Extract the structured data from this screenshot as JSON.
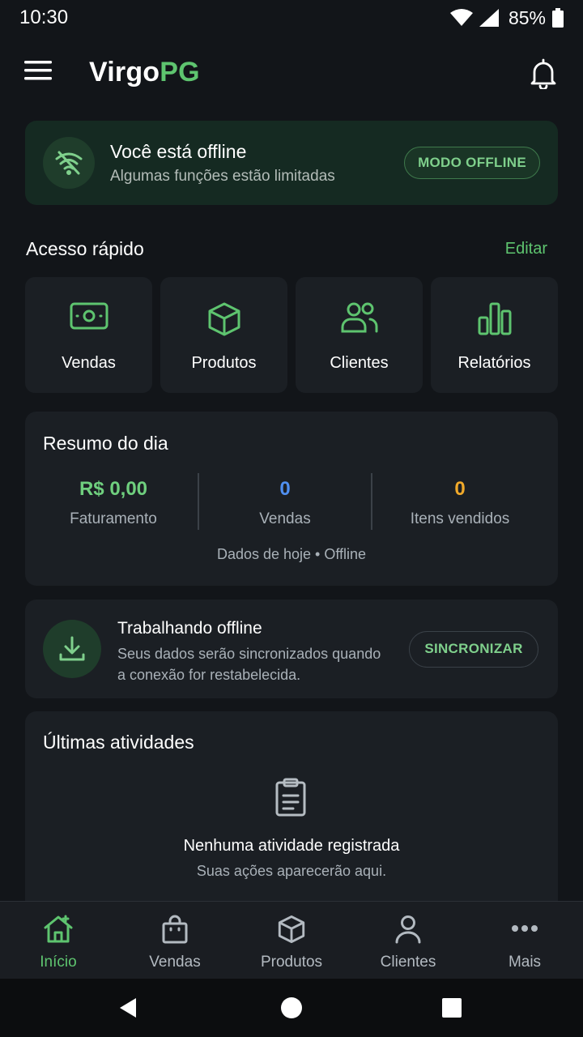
{
  "status_bar": {
    "time": "10:30",
    "battery": "85%"
  },
  "app_bar": {
    "title_main": "Virgo",
    "title_accent": "PG"
  },
  "offline_banner": {
    "title": "Você está offline",
    "subtitle": "Algumas funções estão limitadas",
    "mode_button": "MODO OFFLINE"
  },
  "quick_access": {
    "title": "Acesso rápido",
    "edit_label": "Editar",
    "items": [
      {
        "label": "Vendas",
        "icon": "money-icon"
      },
      {
        "label": "Produtos",
        "icon": "box-icon"
      },
      {
        "label": "Clientes",
        "icon": "users-icon"
      },
      {
        "label": "Relatórios",
        "icon": "bar-chart-icon"
      }
    ]
  },
  "summary": {
    "title": "Resumo do dia",
    "metrics": [
      {
        "value": "R$ 0,00",
        "label": "Faturamento",
        "color": "#6fcf7e"
      },
      {
        "value": "0",
        "label": "Vendas",
        "color": "#4f8ff0"
      },
      {
        "value": "0",
        "label": "Itens vendidos",
        "color": "#f0a92a"
      }
    ],
    "footer": "Dados de hoje • Offline"
  },
  "sync": {
    "title": "Trabalhando offline",
    "subtitle": "Seus dados serão sincronizados quando a conexão for restabelecida.",
    "button": "SINCRONIZAR"
  },
  "activities": {
    "title": "Últimas atividades",
    "empty_title": "Nenhuma atividade registrada",
    "empty_subtitle": "Suas ações aparecerão aqui."
  },
  "bottom_nav": {
    "items": [
      {
        "label": "Início",
        "icon": "home-icon",
        "active": true
      },
      {
        "label": "Vendas",
        "icon": "shopping-bag-icon",
        "active": false
      },
      {
        "label": "Produtos",
        "icon": "box-icon",
        "active": false
      },
      {
        "label": "Clientes",
        "icon": "user-icon",
        "active": false
      },
      {
        "label": "Mais",
        "icon": "more-icon",
        "active": false
      }
    ]
  },
  "colors": {
    "background": "#121519",
    "card": "#1b1f24",
    "accent": "#5ec46f",
    "banner": "#152a22"
  }
}
